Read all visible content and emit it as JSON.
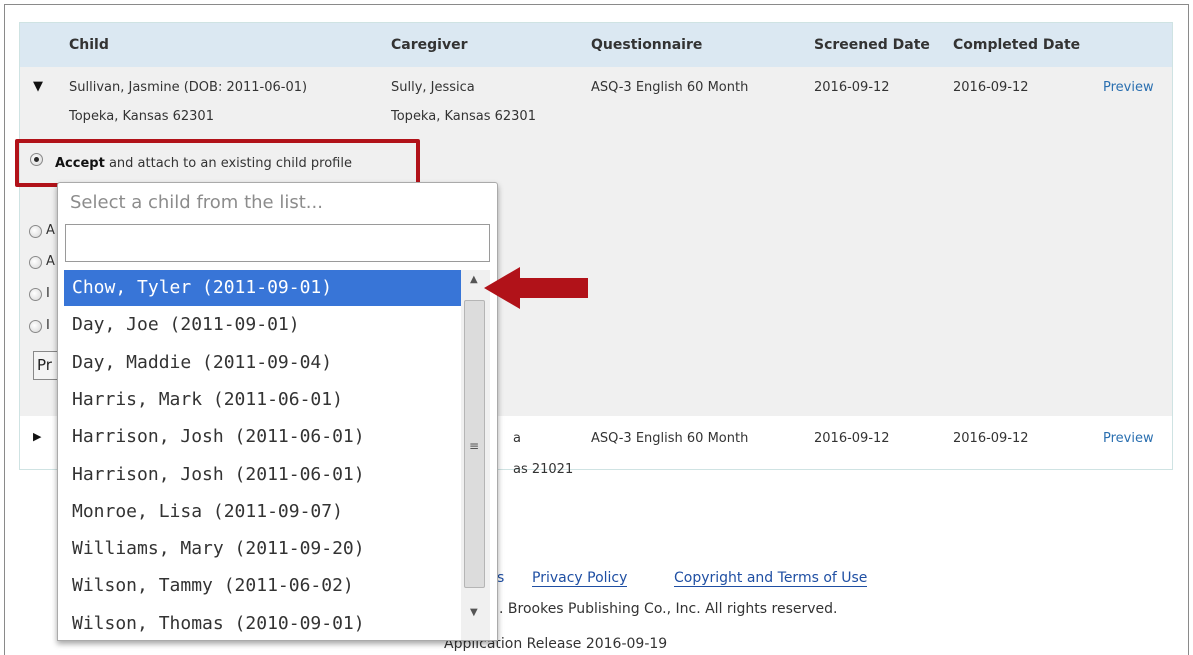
{
  "table": {
    "headers": {
      "child": "Child",
      "caregiver": "Caregiver",
      "questionnaire": "Questionnaire",
      "screened": "Screened Date",
      "completed": "Completed Date"
    },
    "rows": [
      {
        "child": "Sullivan, Jasmine (DOB: 2011-06-01)",
        "child_address": "Topeka, Kansas 62301",
        "caregiver": "Sully, Jessica",
        "caregiver_address": "Topeka, Kansas 62301",
        "questionnaire": "ASQ-3 English 60 Month",
        "screened": "2016-09-12",
        "completed": "2016-09-12",
        "action": "Preview",
        "expanded": true
      },
      {
        "caregiver_fragment": "a",
        "caregiver_address_fragment": "as 21021",
        "questionnaire": "ASQ-3 English 60 Month",
        "screened": "2016-09-12",
        "completed": "2016-09-12",
        "action": "Preview",
        "expanded": false
      }
    ]
  },
  "options": {
    "accept_bold": "Accept",
    "accept_rest": " and attach to an existing child profile",
    "stubs": [
      "A",
      "A",
      "I",
      "I"
    ],
    "process_button_fragment": "Pr"
  },
  "dropdown": {
    "placeholder": "Select a child from the list...",
    "search_value": "",
    "items": [
      "Chow, Tyler (2011-09-01)",
      "Day, Joe (2011-09-01)",
      "Day, Maddie (2011-09-04)",
      "Harris, Mark (2011-06-01)",
      "Harrison, Josh (2011-06-01)",
      "Harrison, Josh (2011-06-01)",
      "Monroe, Lisa (2011-09-07)",
      "Williams, Mary (2011-09-20)",
      "Wilson, Tammy (2011-06-02)",
      "Wilson, Thomas (2010-09-01)"
    ],
    "selected_index": 0
  },
  "footer": {
    "link_fragment": "s",
    "privacy": "Privacy Policy",
    "copyright_terms": "Copyright and Terms of Use",
    "rights": ". Brookes Publishing Co., Inc. All rights reserved.",
    "release": "Application Release 2016-09-19"
  },
  "colors": {
    "header_bg": "#dbe8f2",
    "row_bg": "#f0f0f0",
    "highlight": "#b11219",
    "selected_item": "#3875d7",
    "link": "#2a6fb0"
  },
  "icons": {
    "expanded_row": "triangle-down-icon",
    "collapsed_row": "triangle-right-icon",
    "annotation": "red-arrow-icon"
  }
}
